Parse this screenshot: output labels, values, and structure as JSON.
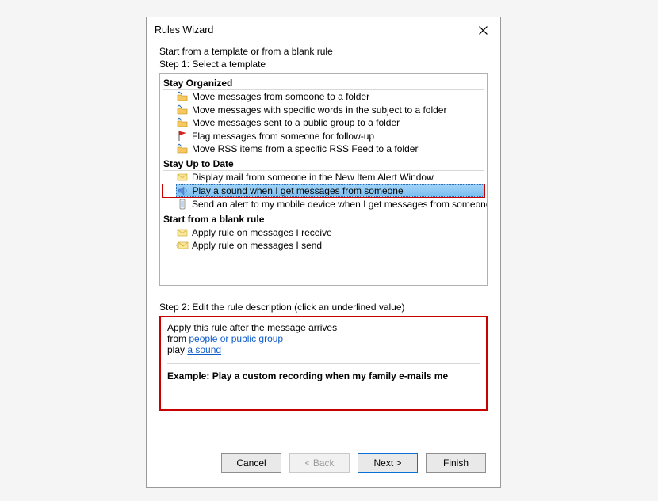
{
  "dialog": {
    "title": "Rules Wizard",
    "intro": "Start from a template or from a blank rule",
    "step1_label": "Step 1: Select a template",
    "step2_label": "Step 2: Edit the rule description (click an underlined value)"
  },
  "sections": {
    "organized": {
      "header": "Stay Organized",
      "items": [
        "Move messages from someone to a folder",
        "Move messages with specific words in the subject to a folder",
        "Move messages sent to a public group to a folder",
        "Flag messages from someone for follow-up",
        "Move RSS items from a specific RSS Feed to a folder"
      ]
    },
    "uptodate": {
      "header": "Stay Up to Date",
      "items": [
        "Display mail from someone in the New Item Alert Window",
        "Play a sound when I get messages from someone",
        "Send an alert to my mobile device when I get messages from someone"
      ]
    },
    "blank": {
      "header": "Start from a blank rule",
      "items": [
        "Apply rule on messages I receive",
        "Apply rule on messages I send"
      ]
    }
  },
  "description": {
    "line1": "Apply this rule after the message arrives",
    "line2_prefix": "from ",
    "line2_link": "people or public group",
    "line3_prefix": "play ",
    "line3_link": "a sound",
    "example": "Example: Play a custom recording when my family e-mails me"
  },
  "buttons": {
    "cancel": "Cancel",
    "back": "< Back",
    "next": "Next >",
    "finish": "Finish"
  }
}
